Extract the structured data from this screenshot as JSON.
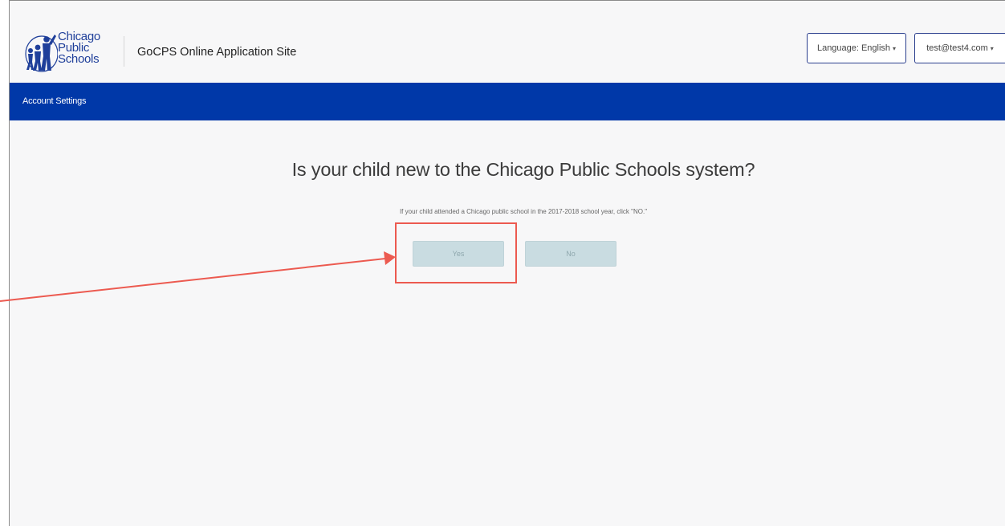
{
  "header": {
    "logo": {
      "line1": "Chicago",
      "line2": "Public",
      "line3": "Schools"
    },
    "site_title": "GoCPS Online Application Site",
    "language_dropdown": {
      "label": "Language:",
      "value": "English"
    },
    "account_dropdown": {
      "value": "test@test4.com"
    }
  },
  "navbar": {
    "items": [
      {
        "label": "Account Settings"
      }
    ]
  },
  "main": {
    "question": "Is your child new to the Chicago Public Schools system?",
    "hint": "If your child attended a Chicago public school in the 2017-2018 school year, click \"NO.\"",
    "buttons": {
      "yes": "Yes",
      "no": "No"
    }
  },
  "annotation": {
    "color": "#ec5a50"
  },
  "colors": {
    "navbar": "#0038a8",
    "brand": "#1f3f9a",
    "button_bg": "#c9dce1"
  },
  "icons": {
    "logo": "cps-figures-logo-icon",
    "caret": "caret-down-icon",
    "arrow": "arrow-right-icon"
  }
}
